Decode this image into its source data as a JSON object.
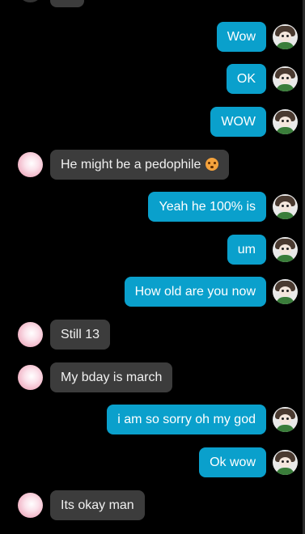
{
  "messages": [
    {
      "from": "me",
      "text": "Wow"
    },
    {
      "from": "me",
      "text": "OK"
    },
    {
      "from": "me",
      "text": "WOW"
    },
    {
      "from": "them",
      "text": "He might be a pedophile",
      "emoji": "flushed-face"
    },
    {
      "from": "me",
      "text": "Yeah he 100% is"
    },
    {
      "from": "me",
      "text": "um"
    },
    {
      "from": "me",
      "text": "How old are you now"
    },
    {
      "from": "them",
      "text": "Still 13"
    },
    {
      "from": "them",
      "text": "My bday is march"
    },
    {
      "from": "me",
      "text": "i am so sorry oh my god"
    },
    {
      "from": "me",
      "text": "Ok wow"
    },
    {
      "from": "them",
      "text": "Its okay man"
    }
  ],
  "colors": {
    "background": "#000000",
    "outgoing_bubble": "#0aa0cc",
    "incoming_bubble": "#3c3c3c",
    "text": "#ffffff"
  }
}
